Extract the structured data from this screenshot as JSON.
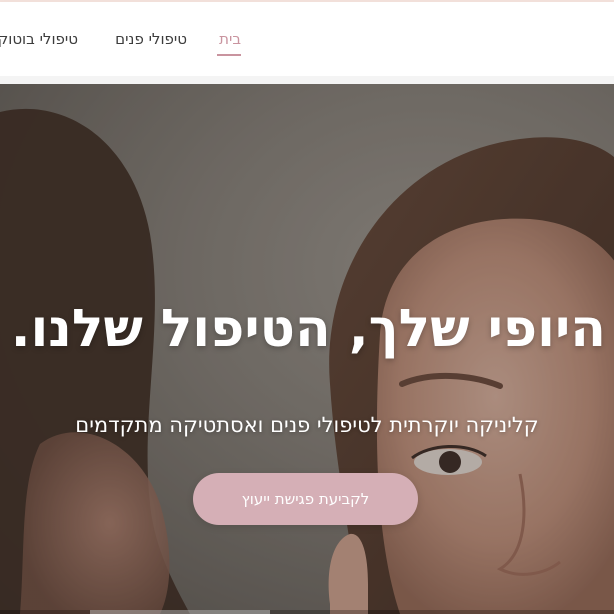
{
  "nav": {
    "items": [
      {
        "label": "בית",
        "active": true
      },
      {
        "label": "טיפולי פנים",
        "active": false
      },
      {
        "label": "טיפולי בוטוקס",
        "active": false
      }
    ],
    "accent_color": "#c9949f"
  },
  "hero": {
    "title": "היופי שלך, הטיפול שלנו.",
    "subtitle": "קליניקה יוקרתית לטיפולי פנים ואסתטיקה מתקדמים",
    "cta_label": "לקביעת פגישת ייעוץ",
    "cta_color": "#d5afb6"
  }
}
